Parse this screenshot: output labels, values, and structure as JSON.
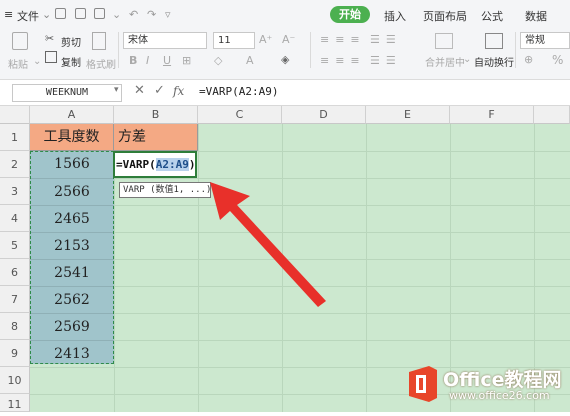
{
  "menu": {
    "hamburger": "≡",
    "file_label": "文件",
    "tabs": [
      {
        "label": "开始",
        "active": true
      },
      {
        "label": "插入"
      },
      {
        "label": "页面布局"
      },
      {
        "label": "公式"
      },
      {
        "label": "数据"
      }
    ]
  },
  "ribbon": {
    "paste": "粘贴",
    "cut": "剪切",
    "copy": "复制",
    "format_painter": "格式刷",
    "font_name": "宋体",
    "font_size": "11",
    "merge_center": "合并居中",
    "wrap_text": "自动换行",
    "number_format": "常规",
    "percent": "%"
  },
  "formula_bar": {
    "name_box": "WEEKNUM",
    "fx_label": "fx",
    "formula": "=VARP(A2:A9)"
  },
  "sheet": {
    "columns": [
      "A",
      "B",
      "C",
      "D",
      "E",
      "F"
    ],
    "rows": [
      "1",
      "2",
      "3",
      "4",
      "5",
      "6",
      "7",
      "8",
      "9",
      "10",
      "11"
    ],
    "header_a1": "工具度数",
    "header_b1": "方差",
    "values": [
      "1566",
      "2566",
      "2465",
      "2153",
      "2541",
      "2562",
      "2569",
      "2413"
    ],
    "b2_prefix": "=VARP(",
    "b2_ref": "A2:A9",
    "b2_suffix": ")",
    "tooltip": "VARP (数值1, ...)"
  },
  "watermark": {
    "brand": "Office教程网",
    "url": "www.office26.com"
  },
  "colors": {
    "accent_green": "#4cb050",
    "sheet_background": "#cce8cf",
    "header_fill": "#f4a984",
    "data_fill": "#a0c4cb",
    "arrow": "#e8302a"
  }
}
